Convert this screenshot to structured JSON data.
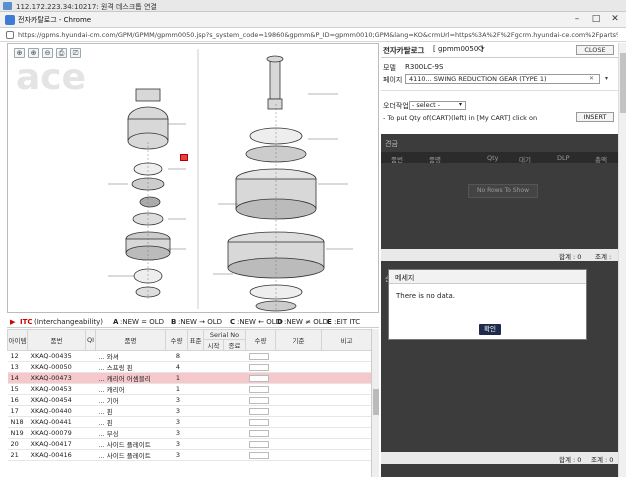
{
  "rdp": {
    "title": "112.172.223.34:10217: 원격 데스크톱 연결"
  },
  "window": {
    "title": "전자카탈로그 - Chrome",
    "minimize": "–",
    "maximize": "□",
    "close": "✕"
  },
  "address": {
    "url": "https://gpms.hyundai-cm.com/GPM/GPMM/gpmm0050.jsp?s_system_code=19860&gpmm&P_ID=gpmm0010;GPM&lang=KO&crmUrl=https%3A%2F%2Fgcrm.hyundai-ce.com%2Fparts%..."
  },
  "viewer": {
    "tools": [
      "⊕",
      "⊕",
      "⊖",
      "⎙",
      "⎚"
    ],
    "watermark": "ace"
  },
  "itc": {
    "prefix": "▶",
    "title": "ITC",
    "title_suffix": "(Interchangeability)",
    "a": {
      "key": "A",
      "text": ":NEW = OLD"
    },
    "b": {
      "key": "B",
      "text": ":NEW → OLD"
    },
    "c": {
      "key": "C",
      "text": ":NEW ← OLD"
    },
    "d": {
      "key": "D",
      "text": ":NEW ≠ OLD"
    },
    "e": {
      "key": "E",
      "text": ":EIT ITC"
    }
  },
  "table": {
    "headers": {
      "item": "아이템",
      "partno": "품번",
      "qi": "QI",
      "name": "품명",
      "qty": "수량",
      "std": "표준",
      "serial": "Serial No",
      "start": "시작",
      "end": "종료",
      "order_qty": "수량",
      "basis": "기준",
      "remark": "비고"
    },
    "rows": [
      {
        "item": "12",
        "partno": "XKAQ-00435",
        "name": "... 와셔",
        "qty": "8"
      },
      {
        "item": "13",
        "partno": "XKAQ-00050",
        "name": "... 스프링 핀",
        "qty": "4"
      },
      {
        "item": "14",
        "partno": "XKAQ-00473",
        "name": "... 캐리어 어셈블리",
        "qty": "1"
      },
      {
        "item": "15",
        "partno": "XKAQ-00453",
        "name": "... 캐리어",
        "qty": "1"
      },
      {
        "item": "16",
        "partno": "XKAQ-00454",
        "name": "... 기어",
        "qty": "3"
      },
      {
        "item": "17",
        "partno": "XKAQ-00440",
        "name": "... 핀",
        "qty": "3"
      },
      {
        "item": "N18",
        "partno": "XKAQ-00441",
        "name": "... 핀",
        "qty": "3"
      },
      {
        "item": "N19",
        "partno": "XKAQ-00079",
        "name": "... 부싱",
        "qty": "3"
      },
      {
        "item": "20",
        "partno": "XKAQ-00417",
        "name": "... 사이드 플레이트",
        "qty": "3"
      },
      {
        "item": "21",
        "partno": "XKAQ-00416",
        "name": "... 사이드 플레이트",
        "qty": "3"
      }
    ]
  },
  "right": {
    "title": "전자카탈로그",
    "code": "[ gpmm0050 ]",
    "refresh_icon": "⟳",
    "close_label": "CLOSE",
    "model_label": "모델",
    "model_value": "R300LC-9S",
    "page_label": "페이지",
    "page_value": "4110... SWING REDUCTION GEAR (TYPE 1)",
    "page_clear": "✕",
    "option_label": "오더작업",
    "option_value": "- select -",
    "instruction": "- To put Qty of(CART)(left) in [My CART] click on",
    "insert_label": "INSERT"
  },
  "cart": {
    "section1": "견금",
    "cols": [
      "품번",
      "품명",
      "Qty",
      "대기",
      "DLP",
      "총액"
    ],
    "none_label": "No Rows To Show",
    "total1": "합계 : 0",
    "total1_suffix": "조계 :",
    "section2": "순서",
    "total2": "합계 : 0",
    "total2_suffix": "조계 : 0"
  },
  "modal": {
    "title": "메세지",
    "body": "There is no data.",
    "ok": "확인"
  }
}
